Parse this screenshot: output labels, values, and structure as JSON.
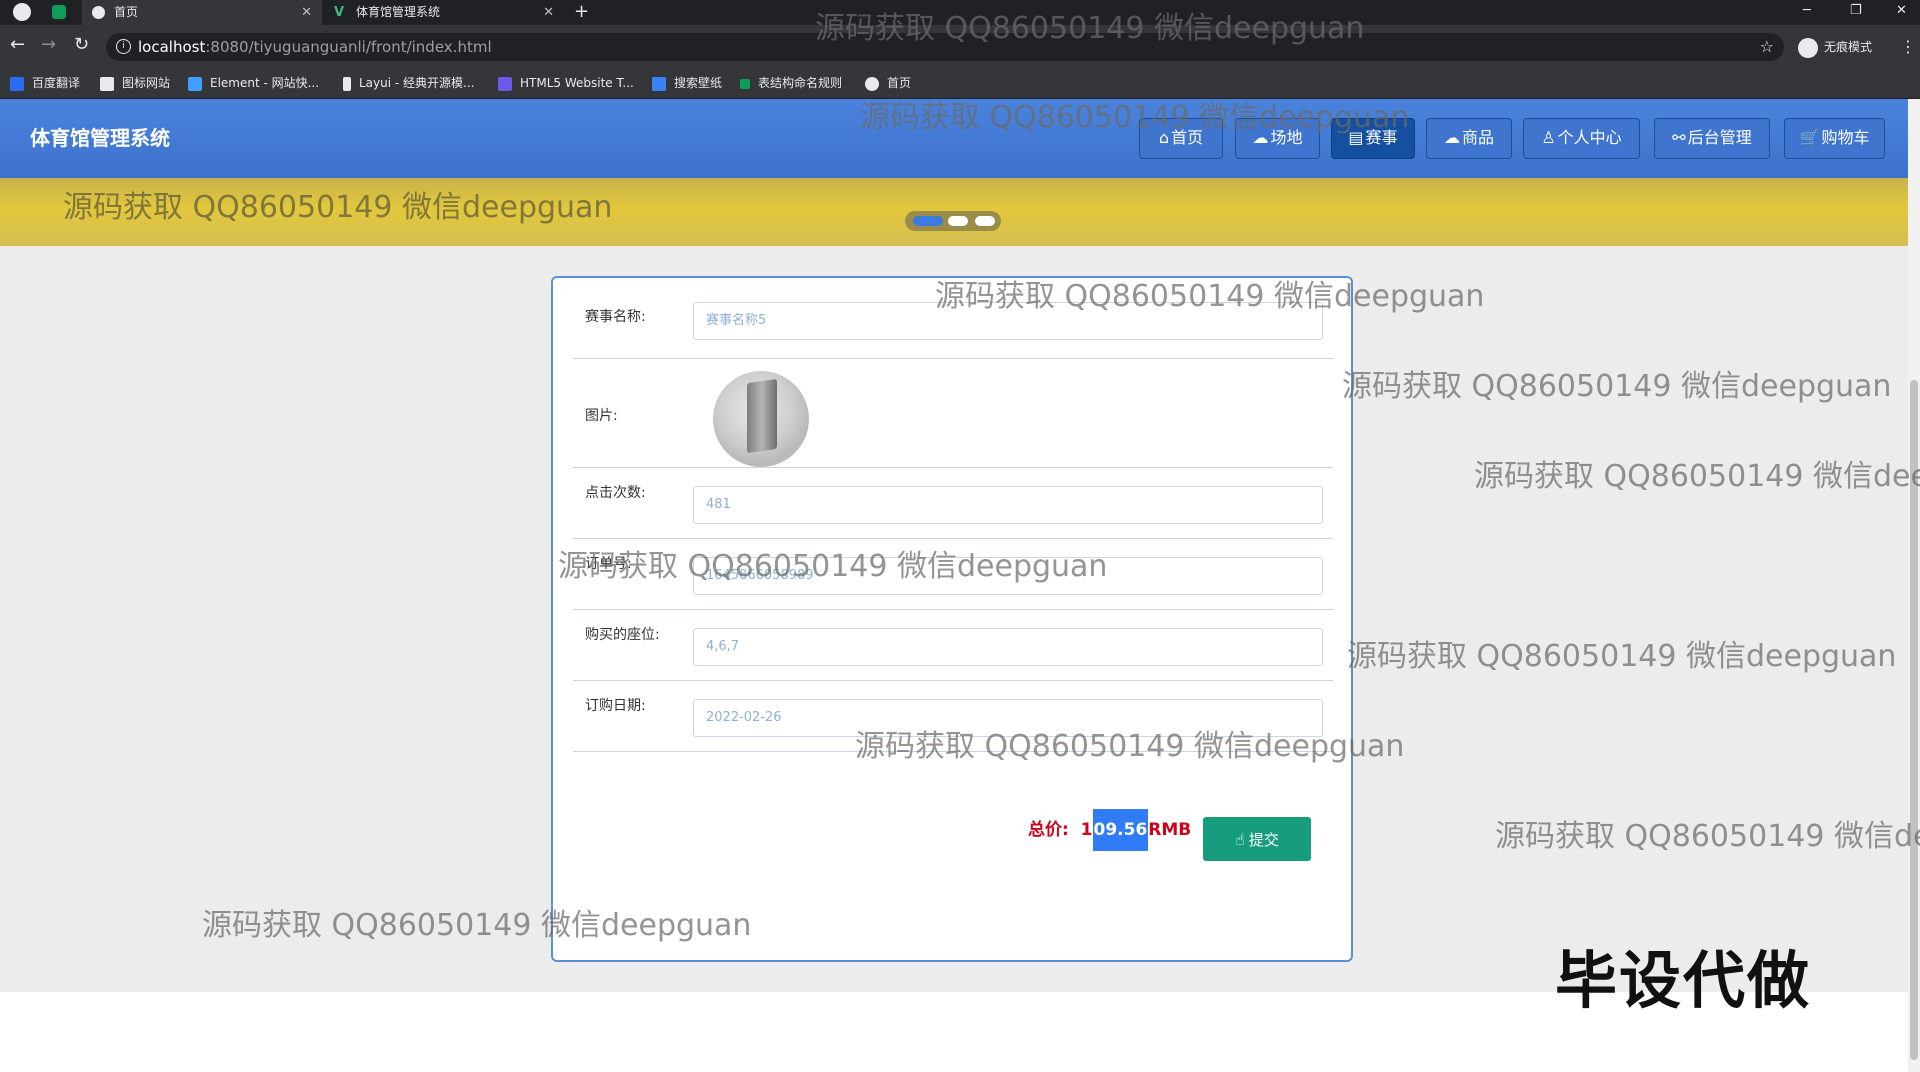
{
  "browser": {
    "tabs": [
      {
        "title": "首页",
        "active": true
      },
      {
        "title": "体育馆管理系统",
        "active": false
      }
    ],
    "new_tab": "+",
    "url_host": "localhost",
    "url_path": ":8080/tiyuguanguanli/front/index.html",
    "incognito_label": "无痕模式",
    "bookmarks": [
      {
        "label": "百度翻译",
        "color": "#2a6df4"
      },
      {
        "label": "图标网站",
        "color": "#e8eaed"
      },
      {
        "label": "Element - 网站快...",
        "color": "#409eff"
      },
      {
        "label": "Layui - 经典开源模...",
        "color": "#e8eaed"
      },
      {
        "label": "HTML5 Website T...",
        "color": "#6b5be8"
      },
      {
        "label": "搜索壁纸",
        "color": "#3b82f6"
      },
      {
        "label": "表结构命名规则",
        "color": "#0f9d58"
      },
      {
        "label": "首页",
        "color": "#e8eaed"
      }
    ]
  },
  "site": {
    "title": "体育馆管理系统",
    "nav": [
      {
        "label": "首页",
        "icon": "home-icon",
        "active": false
      },
      {
        "label": "场地",
        "icon": "venue-icon",
        "active": false
      },
      {
        "label": "赛事",
        "icon": "event-icon",
        "active": true
      },
      {
        "label": "商品",
        "icon": "goods-icon",
        "active": false
      },
      {
        "label": "个人中心",
        "icon": "user-icon",
        "active": false
      },
      {
        "label": "后台管理",
        "icon": "link-icon",
        "active": false
      },
      {
        "label": "购物车",
        "icon": "cart-icon",
        "active": false
      }
    ],
    "carousel_active_index": 0
  },
  "form": {
    "event_name": {
      "label": "赛事名称:",
      "value": "赛事名称5"
    },
    "image": {
      "label": "图片:"
    },
    "clicks": {
      "label": "点击次数:",
      "value": "481"
    },
    "order_no": {
      "label": "订单号:",
      "value": "1645866058989"
    },
    "seats": {
      "label": "购买的座位:",
      "value": "4,6,7"
    },
    "order_date": {
      "label": "订购日期:",
      "value": "2022-02-26"
    },
    "total_label": "总价:",
    "total_prefix": "1",
    "total_selected": "09.56",
    "total_suffix": "RMB",
    "submit_label": "提交"
  },
  "overlay": {
    "watermark": "源码获取 QQ86050149 微信deepguan",
    "watermark_cut": "源码获取 QQ86050149 微信dee",
    "watermark_cut2": "源码获取 QQ86050149 微信de",
    "promo": "毕设代做"
  },
  "colors": {
    "header_blue": "#3d72cc",
    "active_nav": "#14509f",
    "submit_green": "#179c7e",
    "price_red": "#d0021b"
  }
}
